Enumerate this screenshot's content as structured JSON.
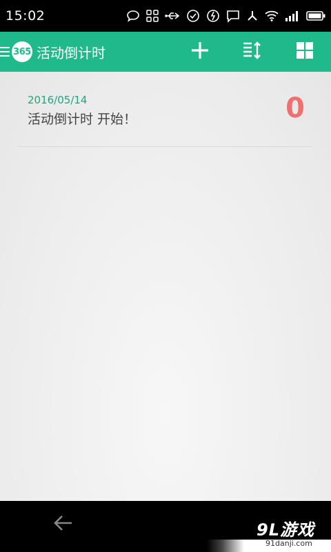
{
  "status_bar": {
    "time": "15:02",
    "icons": [
      "chat-bubble-icon",
      "apps-grid-icon",
      "usb-icon",
      "check-circle-icon",
      "sync-icon",
      "message-icon",
      "share-icon",
      "wifi-icon",
      "signal-icon",
      "battery-icon"
    ]
  },
  "app_bar": {
    "logo_text": "365",
    "title": "活动倒计时",
    "actions": [
      "add-icon",
      "sort-icon",
      "grid-view-icon"
    ]
  },
  "events": [
    {
      "date": "2016/05/14",
      "name": "活动倒计时 开始！",
      "count": "0"
    }
  ],
  "nav_bar": {
    "watermark": "9L游戏",
    "watermark_url": "91danji.com"
  },
  "colors": {
    "accent": "#1fb98c",
    "count": "#f07070",
    "date": "#1fa57e"
  }
}
